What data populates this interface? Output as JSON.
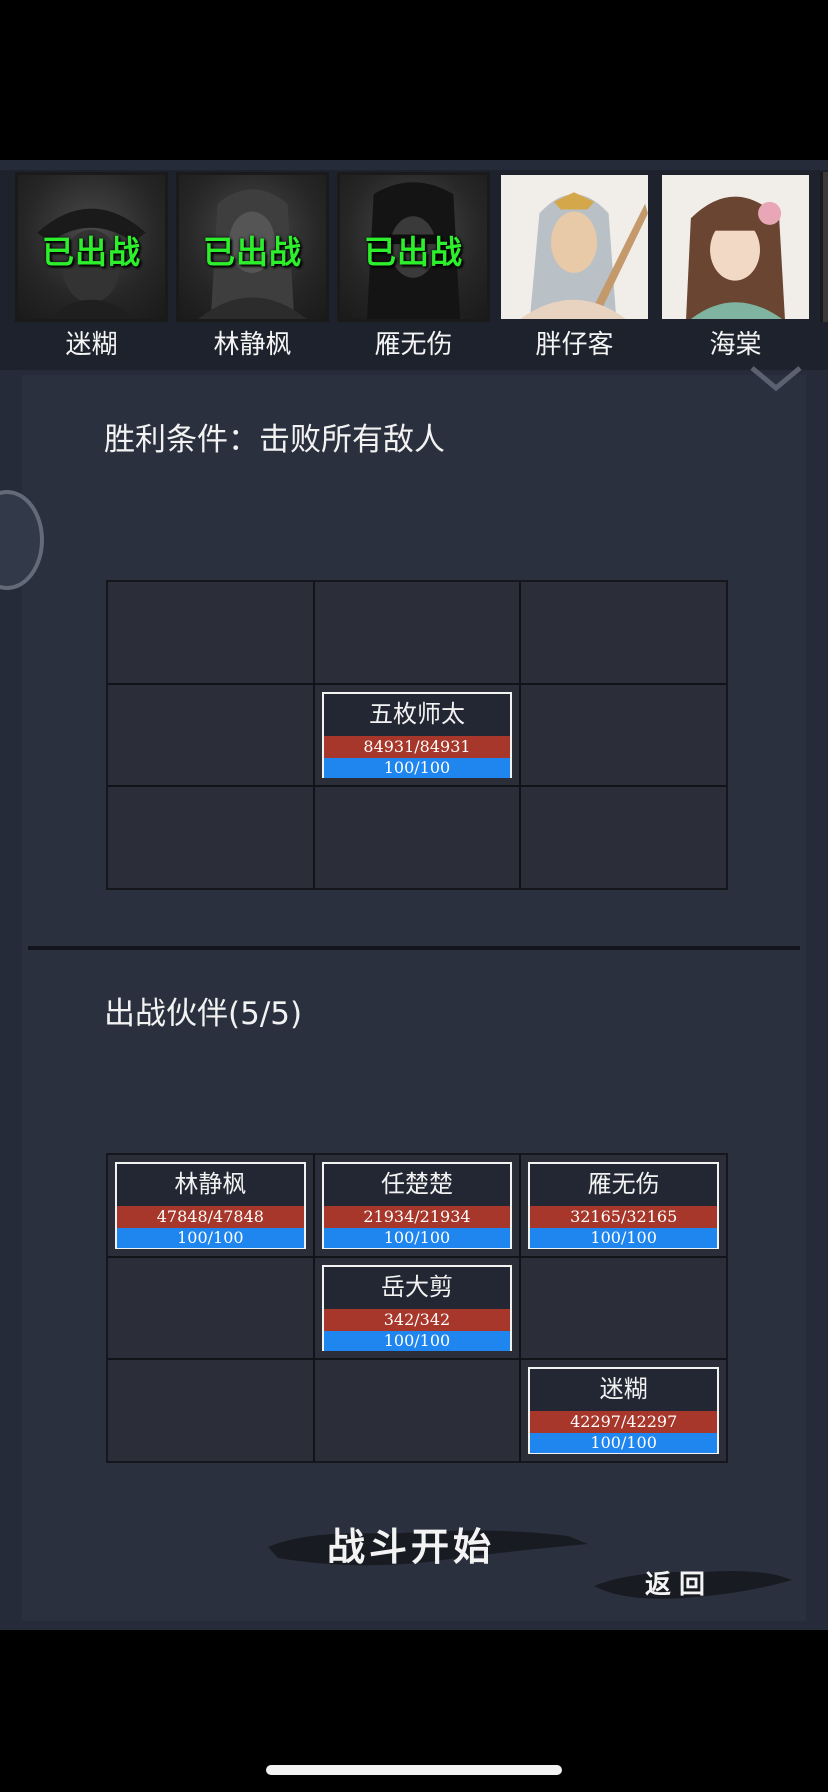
{
  "roster": [
    {
      "name": "迷糊",
      "status": "已出战",
      "deployed": true
    },
    {
      "name": "林静枫",
      "status": "已出战",
      "deployed": true
    },
    {
      "name": "雁无伤",
      "status": "已出战",
      "deployed": true
    },
    {
      "name": "胖仔客",
      "status": "",
      "deployed": false
    },
    {
      "name": "海棠",
      "status": "",
      "deployed": false
    }
  ],
  "victory_condition": "胜利条件：击败所有敌人",
  "enemy_grid": [
    null,
    null,
    null,
    null,
    {
      "name": "五枚师太",
      "hp": "84931/84931",
      "mp": "100/100"
    },
    null,
    null,
    null,
    null
  ],
  "party_title": "出战伙伴(5/5)",
  "party_grid": [
    {
      "name": "林静枫",
      "hp": "47848/47848",
      "mp": "100/100"
    },
    {
      "name": "任楚楚",
      "hp": "21934/21934",
      "mp": "100/100"
    },
    {
      "name": "雁无伤",
      "hp": "32165/32165",
      "mp": "100/100"
    },
    null,
    {
      "name": "岳大剪",
      "hp": "342/342",
      "mp": "100/100"
    },
    null,
    null,
    null,
    {
      "name": "迷糊",
      "hp": "42297/42297",
      "mp": "100/100"
    }
  ],
  "start_button": "战斗开始",
  "back_button": "返回",
  "colors": {
    "panel_bg": "#2a303d",
    "deployed_text": "#2cf02c",
    "hp_bar": "#a8372b",
    "mp_bar": "#1f86f0"
  }
}
